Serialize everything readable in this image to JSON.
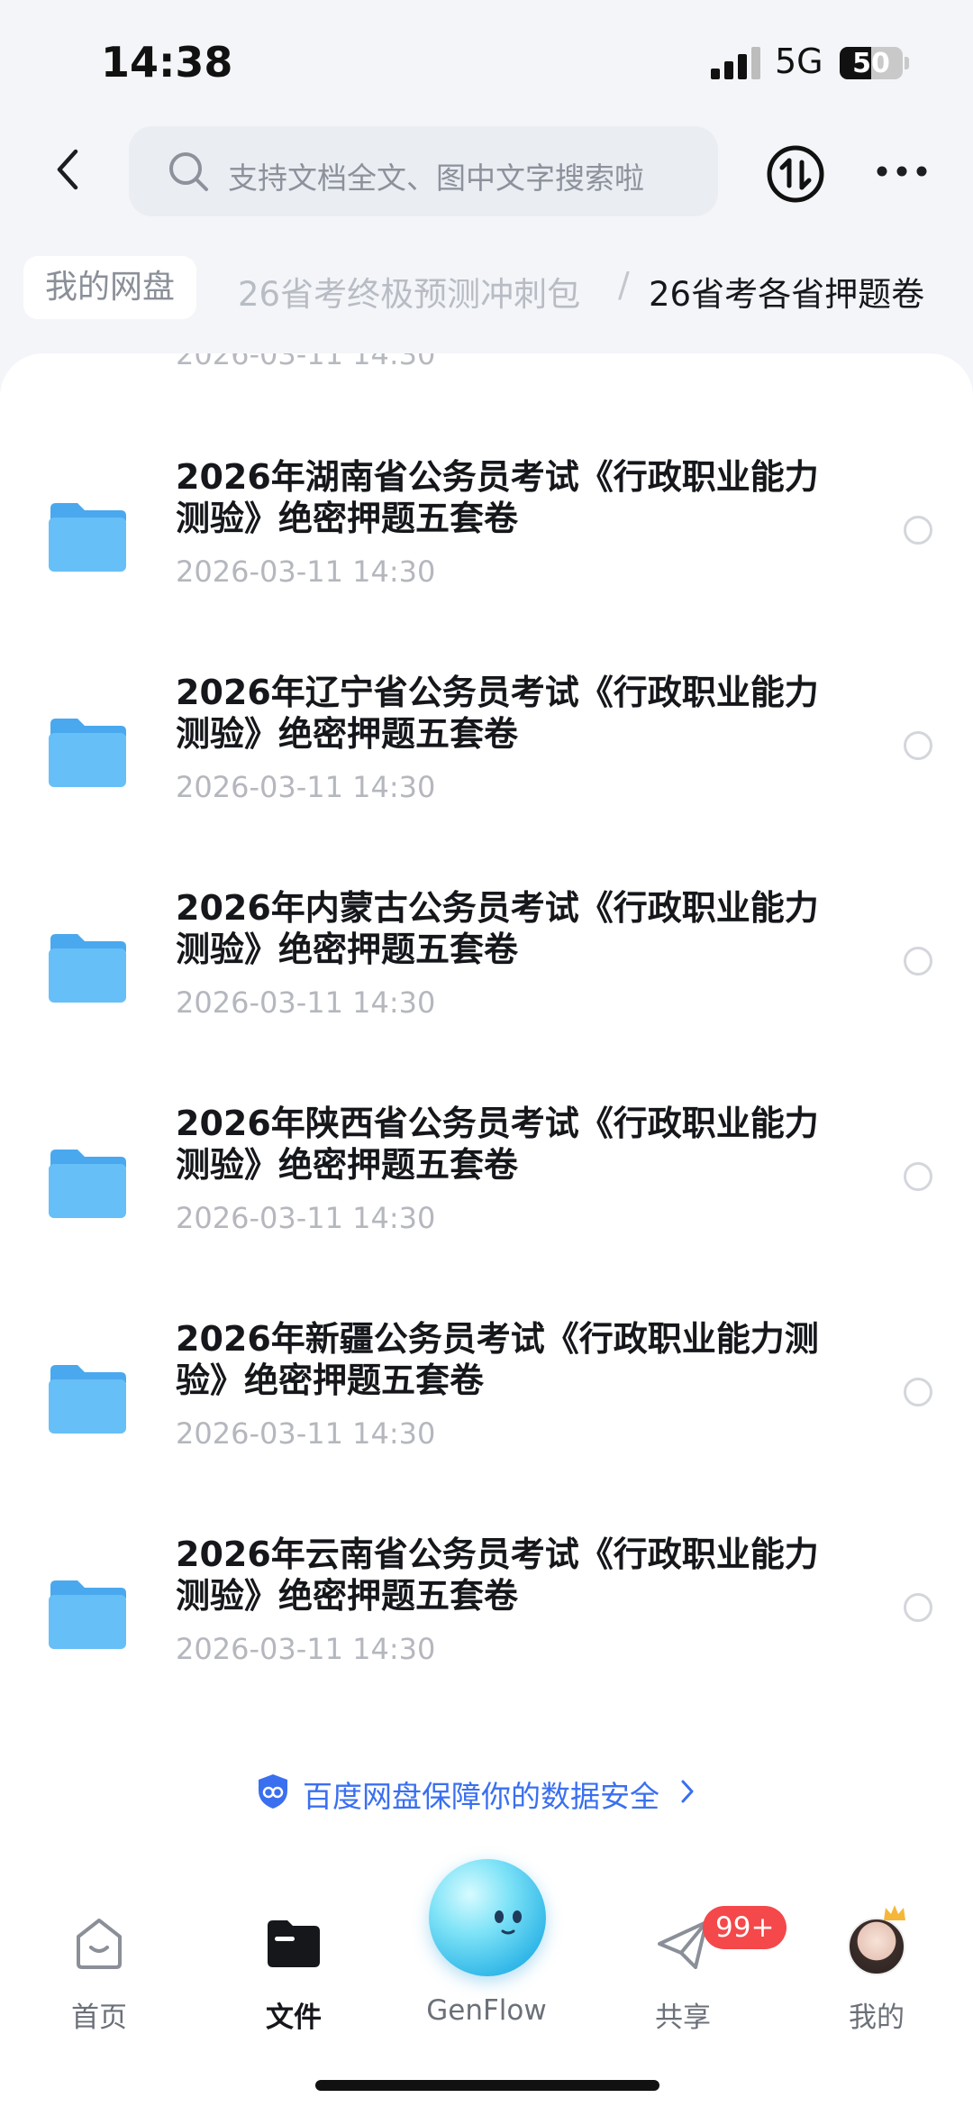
{
  "status_bar": {
    "time": "14:38",
    "network": "5G",
    "battery": "50",
    "battery_level": 0.5
  },
  "header": {
    "search_placeholder": "支持文档全文、图中文字搜索啦",
    "icons": [
      "back-arrow-icon",
      "search-icon",
      "transfer-icon",
      "more-icon"
    ]
  },
  "breadcrumb": {
    "root": "我的网盘",
    "parent": "26省考终极预测冲刺包",
    "separator": "/",
    "current": "26省考各省押题卷"
  },
  "files": {
    "partial_top_date": "2026-03-11 14:30",
    "items": [
      {
        "name": "2026年湖南省公务员考试《行政职业能力测验》绝密押题五套卷",
        "date": "2026-03-11 14:30"
      },
      {
        "name": "2026年辽宁省公务员考试《行政职业能力测验》绝密押题五套卷",
        "date": "2026-03-11 14:30"
      },
      {
        "name": "2026年内蒙古公务员考试《行政职业能力测验》绝密押题五套卷",
        "date": "2026-03-11 14:30"
      },
      {
        "name": "2026年陕西省公务员考试《行政职业能力测验》绝密押题五套卷",
        "date": "2026-03-11 14:30"
      },
      {
        "name": "2026年新疆公务员考试《行政职业能力测验》绝密押题五套卷",
        "date": "2026-03-11 14:30"
      },
      {
        "name": "2026年云南省公务员考试《行政职业能力测验》绝密押题五套卷",
        "date": "2026-03-11 14:30"
      }
    ]
  },
  "security_note": "百度网盘保障你的数据安全",
  "bottom_nav": {
    "home": "首页",
    "files": "文件",
    "genflow": "GenFlow",
    "share": "共享",
    "share_badge": "99+",
    "me": "我的"
  },
  "colors": {
    "accent": "#3a6ff0",
    "folder": "#5bb8f5",
    "badge": "#f4484a"
  }
}
